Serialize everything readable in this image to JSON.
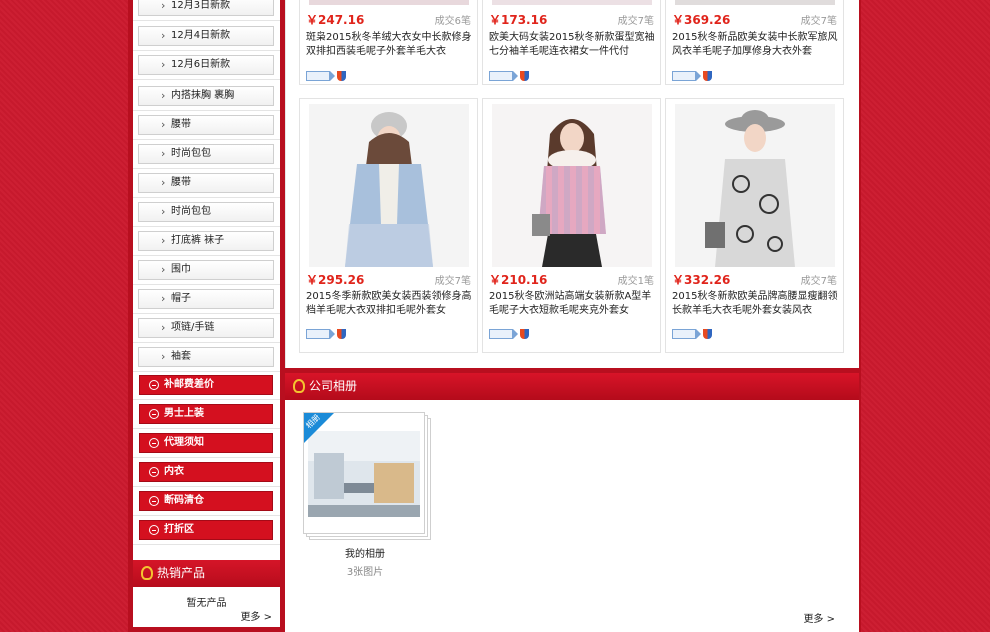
{
  "sidebar": {
    "categories": [
      "12月3日新款",
      "12月4日新款",
      "12月6日新款",
      "内搭抹胸 裹胸",
      "腰带",
      "时尚包包",
      "腰带",
      "时尚包包",
      "打底裤 袜子",
      "围巾",
      "帽子",
      "项链/手链",
      "袖套"
    ],
    "highlight_categories": [
      "补邮费差价",
      "男士上装",
      "代理须知",
      "内衣",
      "断码清仓",
      "打折区"
    ],
    "hot_title": "热销产品",
    "hot_empty": "暂无产品",
    "hot_more": "更多 >"
  },
  "products_top": [
    {
      "price": "￥247.16",
      "sold": "成交6笔",
      "title": "斑枭2015秋冬羊绒大衣女中长款修身双排扣西装毛呢子外套羊毛大衣"
    },
    {
      "price": "￥173.16",
      "sold": "成交7笔",
      "title": "欧美大码女装2015秋冬新款蛋型宽袖七分袖羊毛呢连衣裙女一件代付"
    },
    {
      "price": "￥369.26",
      "sold": "成交7笔",
      "title": "2015秋冬新品欧美女装中长款军旅风风衣羊毛呢子加厚修身大衣外套"
    }
  ],
  "products": [
    {
      "price": "￥295.26",
      "sold": "成交7笔",
      "title": "2015冬季新款欧美女装西装领修身高档羊毛呢大衣双排扣毛呢外套女",
      "colors": [
        "#a8c0dc",
        "#f0eee8",
        "#d8b8a8"
      ]
    },
    {
      "price": "￥210.16",
      "sold": "成交1笔",
      "title": "2015秋冬欧洲站高端女装新款A型羊毛呢子大衣短款毛呢夹克外套女",
      "colors": [
        "#e6a8c0",
        "#b8a8c8",
        "#f6f0ec"
      ]
    },
    {
      "price": "￥332.26",
      "sold": "成交7笔",
      "title": "2015秋冬新款欧美品牌高腰显瘦翻领长款羊毛大衣毛呢外套女装风衣",
      "colors": [
        "#9a9a9a",
        "#d8d8d8",
        "#333333"
      ]
    }
  ],
  "album": {
    "section_title": "公司相册",
    "ribbon": "相册",
    "name": "我的相册",
    "count": "3张图片",
    "more": "更多 >"
  }
}
